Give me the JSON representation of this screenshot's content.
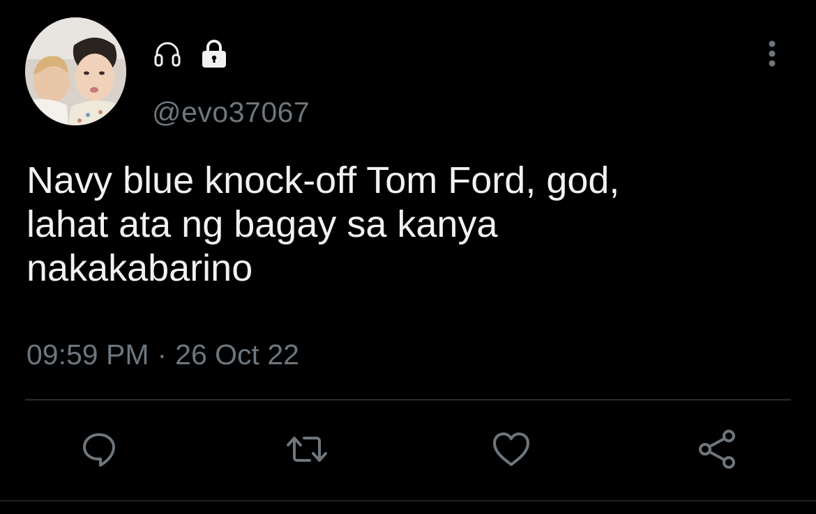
{
  "user": {
    "handle": "@evo37067",
    "badges": [
      "headphones-icon",
      "lock-icon"
    ]
  },
  "tweet": {
    "text": "Navy blue knock-off Tom Ford, god,\nlahat ata ng bagay sa kanya\nnakakabarino",
    "time": "09:59 PM",
    "separator": "·",
    "date": "26 Oct 22"
  },
  "actions": [
    "reply-icon",
    "retweet-icon",
    "like-icon",
    "share-icon"
  ],
  "colors": {
    "background": "#000000",
    "text": "#f1f1f1",
    "muted": "#6e767d",
    "icon": "#6e767d",
    "divider": "#2a2d30"
  }
}
